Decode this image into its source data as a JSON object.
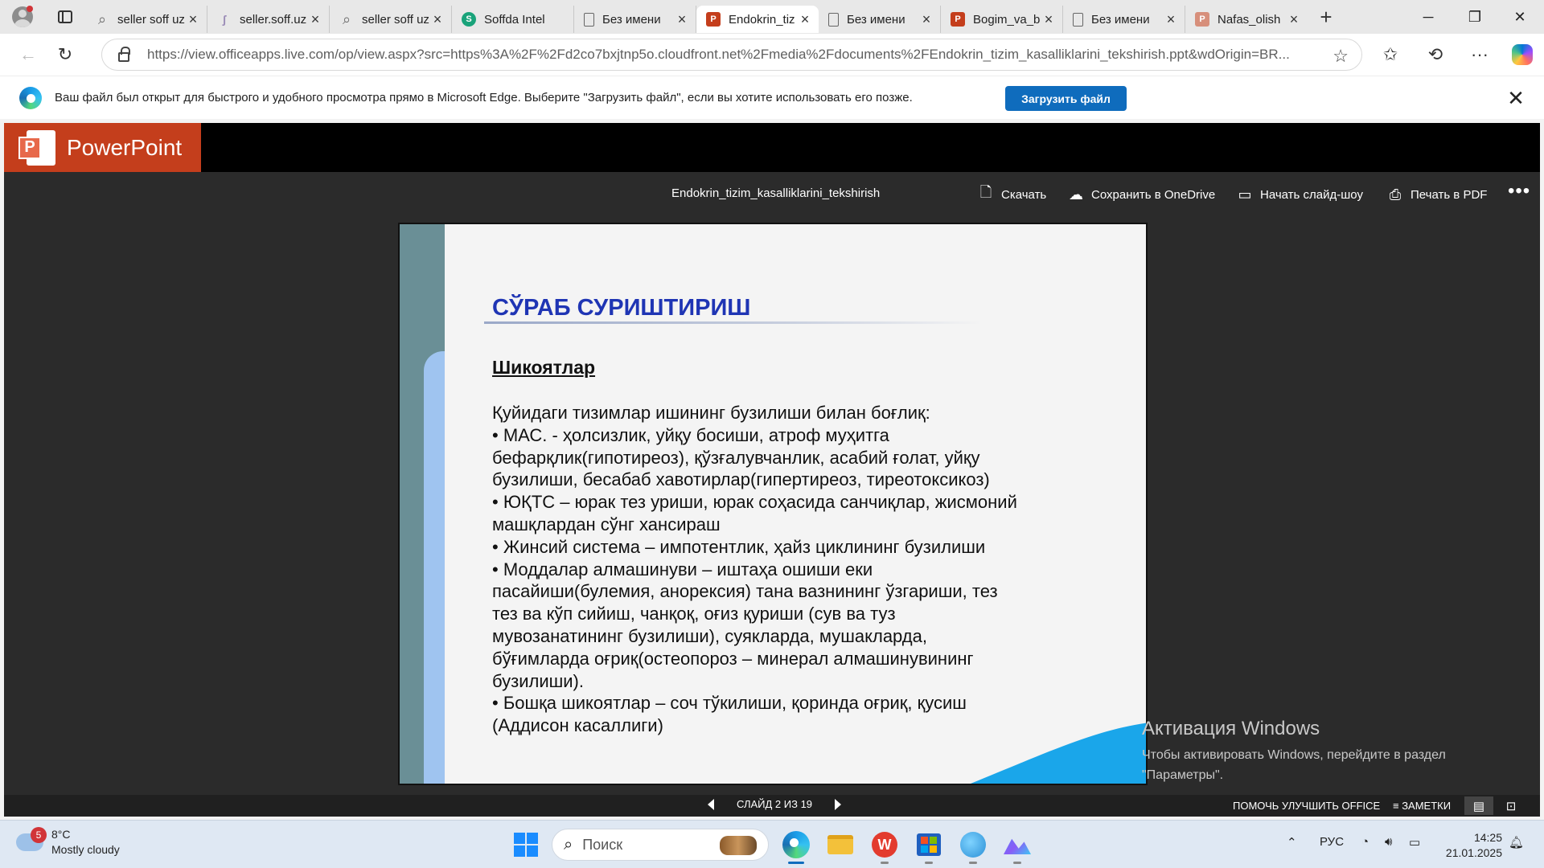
{
  "browser": {
    "tabs": [
      {
        "title": "seller soff uz",
        "icon": "search-icon"
      },
      {
        "title": "seller.soff.uz",
        "icon": "soff-site-icon"
      },
      {
        "title": "seller soff uz",
        "icon": "search-icon"
      },
      {
        "title": "Soffda Intel",
        "icon": "soff-logo-icon"
      },
      {
        "title": "Без имени",
        "icon": "document-icon"
      },
      {
        "title": "Endokrin_tiz",
        "icon": "powerpoint-icon",
        "active": true
      },
      {
        "title": "Без имени",
        "icon": "document-icon"
      },
      {
        "title": "Bogim_va_b",
        "icon": "powerpoint-icon"
      },
      {
        "title": "Без имени",
        "icon": "document-icon"
      },
      {
        "title": "Nafas_olish",
        "icon": "powerpoint-icon"
      }
    ],
    "url": "https://view.officeapps.live.com/op/view.aspx?src=https%3A%2F%2Fd2co7bxjtnp5o.cloudfront.net%2Fmedia%2Fdocuments%2FEndokrin_tizim_kasalliklarini_tekshirish.ppt&wdOrigin=BR..."
  },
  "infobar": {
    "message": "Ваш файл был открыт для быстрого и удобного просмотра прямо в Microsoft Edge. Выберите \"Загрузить файл\", если вы хотите использовать его позже.",
    "button": "Загрузить файл"
  },
  "viewer": {
    "app_name": "PowerPoint",
    "doc_name": "Endokrin_tizim_kasalliklarini_tekshirish",
    "commands": {
      "download": "Скачать",
      "onedrive": "Сохранить в OneDrive",
      "slideshow": "Начать слайд-шоу",
      "print": "Печать в PDF"
    },
    "footer": {
      "slide_counter": "СЛАЙД 2 ИЗ 19",
      "improve": "ПОМОЧЬ УЛУЧШИТЬ OFFICE",
      "notes": "ЗАМЕТКИ"
    }
  },
  "slide": {
    "title": "СЎРАБ СУРИШТИРИШ",
    "subtitle": "Шикоятлар",
    "lines": [
      "Қуйидаги тизимлар ишининг бузилиши билан боғлиқ:",
      "• МАС. - ҳолсизлик, уйқу босиши, атроф муҳитга",
      "бефарқлик(гипотиреоз), қўзғалувчанлик, асабий ғолат, уйқу",
      "бузилиши, бесабаб хавотирлар(гипертиреоз, тиреотоксикоз)",
      "• ЮҚТС – юрак тез уриши, юрак соҳасида санчиқлар, жисмоний",
      "машқлардан сўнг хансираш",
      "• Жинсий система – импотентлик, ҳайз циклининг бузилиши",
      "• Моддалар алмашинуви – иштаҳа ошиши еки",
      "пасайиши(булемия, анорексия) тана вазнининг ўзгариши, тез",
      "тез ва кўп сийиш, чанқоқ, оғиз қуриши (сув ва туз",
      "мувозанатининг бузилиши), суякларда, мушакларда,",
      "бўғимларда оғриқ(остеопороз – минерал алмашинувининг",
      "бузилиши).",
      "• Бошқа шикоятлар – соч тўкилиши, қоринда оғриқ, қусиш",
      "(Аддисон касаллиги)"
    ]
  },
  "activation": {
    "title": "Активация Windows",
    "line1": "Чтобы активировать Windows, перейдите в раздел",
    "line2": "\"Параметры\"."
  },
  "taskbar": {
    "weather_badge": "5",
    "temperature": "8°C",
    "condition": "Mostly cloudy",
    "search_placeholder": "Поиск",
    "language": "РУС",
    "time": "14:25",
    "date": "21.01.2025"
  },
  "colors": {
    "ppt_brand": "#c43e1c",
    "slide_title": "#1f35b4",
    "edge_accent": "#0f6cbd"
  }
}
